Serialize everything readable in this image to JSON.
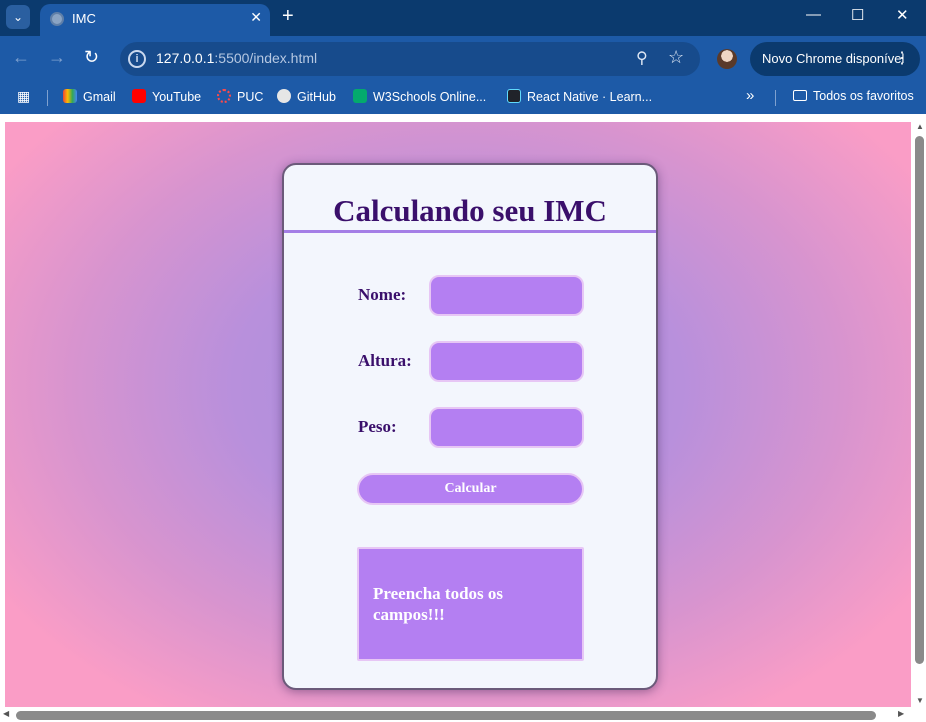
{
  "browser": {
    "tab_title": "IMC",
    "url_host": "127.0.0.1",
    "url_path": ":5500/index.html",
    "update_label": "Novo Chrome disponível",
    "accent": "#1d5aa7",
    "bookmarks": [
      {
        "label": "Gmail",
        "icon": "gmail-icon"
      },
      {
        "label": "YouTube",
        "icon": "youtube-icon"
      },
      {
        "label": "PUC",
        "icon": "puc-icon"
      },
      {
        "label": "GitHub",
        "icon": "github-icon"
      },
      {
        "label": "W3Schools Online...",
        "icon": "w3schools-icon"
      },
      {
        "label": "React Native · Learn...",
        "icon": "react-icon"
      }
    ],
    "all_bookmarks_label": "Todos os favoritos"
  },
  "page": {
    "title": "Calculando seu IMC",
    "fields": [
      {
        "label": "Nome:",
        "value": ""
      },
      {
        "label": "Altura:",
        "value": ""
      },
      {
        "label": "Peso:",
        "value": ""
      }
    ],
    "button_label": "Calcular",
    "result_message": "Preencha todos os campos!!!",
    "colors": {
      "title": "#3a0f6b",
      "input": "#b47ff2",
      "card": "#f3f6fd"
    }
  }
}
